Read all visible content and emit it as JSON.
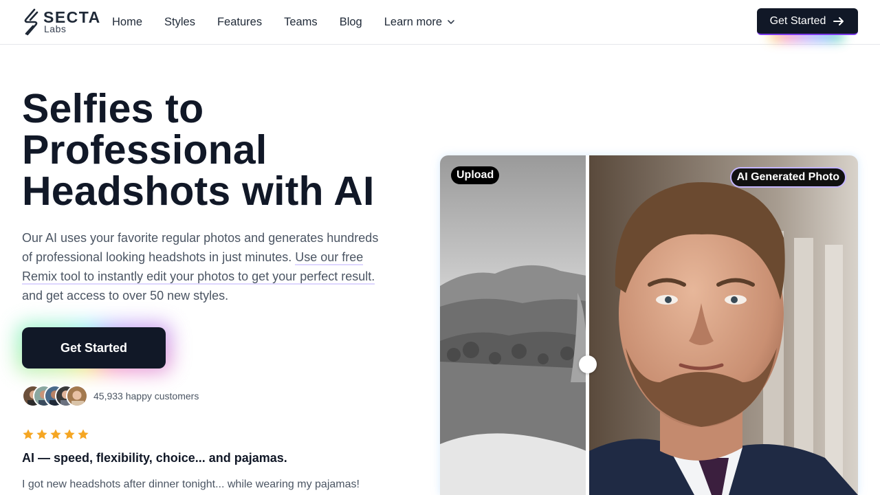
{
  "header": {
    "logo": {
      "word": "SECTA",
      "sub": "Labs"
    },
    "nav": [
      {
        "label": "Home"
      },
      {
        "label": "Styles"
      },
      {
        "label": "Features"
      },
      {
        "label": "Teams"
      },
      {
        "label": "Blog"
      },
      {
        "label": "Learn more",
        "icon": "chevron-down-icon"
      }
    ],
    "cta_label": "Get Started",
    "cta_icon": "arrow-right-icon"
  },
  "hero": {
    "title": "Selfies to Professional Headshots with AI",
    "desc_before": "Our AI uses your favorite regular photos and generates hundreds of professional looking headshots in just minutes. ",
    "desc_link": "Use our free Remix tool to instantly edit your photos to get your perfect result.",
    "desc_after": " and get access to over 50 new styles.",
    "cta_label": "Get Started",
    "customers_text": "45,933 happy customers",
    "rating_stars": 5,
    "review_title": "AI — speed, flexibility, choice... and pajamas.",
    "review_text": "I got new headshots after dinner tonight... while wearing my pajamas!"
  },
  "compare": {
    "left_label": "Upload",
    "right_label": "AI Generated Photo",
    "slider_position": 0.35
  },
  "colors": {
    "primary": "#111827",
    "text_muted": "#4b5563",
    "link_underline": "#ddd6fe",
    "star": "#f5a623",
    "ai_tag_border": "#c4b5fd"
  }
}
